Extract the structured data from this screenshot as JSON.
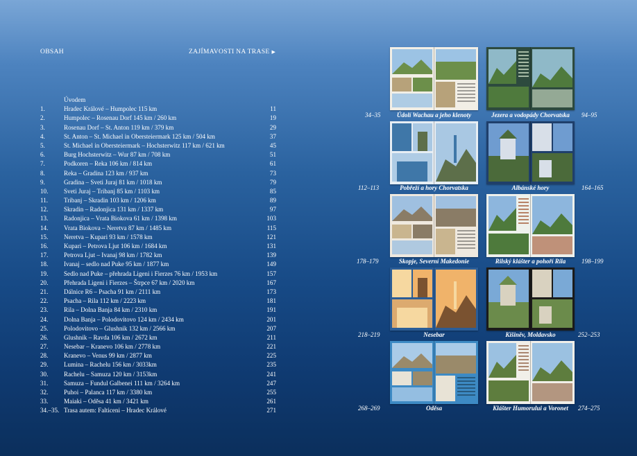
{
  "header": {
    "left": "OBSAH",
    "right": "ZAJÍMAVOSTI NA TRASE"
  },
  "toc": [
    {
      "num": "",
      "title": "Úvodem",
      "page": ""
    },
    {
      "num": "1.",
      "title": "Hradec Králové – Humpolec 115 km",
      "page": "11"
    },
    {
      "num": "2.",
      "title": "Humpolec – Rosenau Dorf 145 km / 260 km",
      "page": "19"
    },
    {
      "num": "3.",
      "title": "Rosenau Dorf – St. Anton 119 km / 379 km",
      "page": "29"
    },
    {
      "num": "4.",
      "title": "St. Anton – St. Michael in Obersteiermark 125 km / 504 km",
      "page": "37"
    },
    {
      "num": "5.",
      "title": "St. Michael in Obersteiermark – Hochsterwitz 117 km / 621 km",
      "page": "45"
    },
    {
      "num": "6.",
      "title": "Burg Hochsterwitz – Wur 87 km / 708 km",
      "page": "51"
    },
    {
      "num": "7.",
      "title": "Podkoren – Reka 106 km / 814 km",
      "page": "61"
    },
    {
      "num": "8.",
      "title": "Reka – Gradina 123 km / 937 km",
      "page": "73"
    },
    {
      "num": "9.",
      "title": "Gradina – Sveti Juraj 81 km / 1018 km",
      "page": "79"
    },
    {
      "num": "10.",
      "title": "Sveti Juraj – Tribanj 85 km / 1103 km",
      "page": "85"
    },
    {
      "num": "11.",
      "title": "Tribanj – Skradin 103 km / 1206 km",
      "page": "89"
    },
    {
      "num": "12.",
      "title": "Skradin – Radonjica 131 km / 1337 km",
      "page": "97"
    },
    {
      "num": "13.",
      "title": "Radonjica – Vrata Biokova 61 km / 1398 km",
      "page": "103"
    },
    {
      "num": "14.",
      "title": "Vrata Biokova – Neretva 87 km / 1485 km",
      "page": "115"
    },
    {
      "num": "15.",
      "title": "Neretva – Kupari  93 km / 1578 km",
      "page": "121"
    },
    {
      "num": "16.",
      "title": "Kupari – Petrova Ljut 106 km / 1684 km",
      "page": "131"
    },
    {
      "num": "17.",
      "title": "Petrova Ljut – Ivanaj  98 km / 1782 km",
      "page": "139"
    },
    {
      "num": "18.",
      "title": "Ivanaj – sedlo nad Puke  95 km / 1877 km",
      "page": "149"
    },
    {
      "num": "19.",
      "title": "Sedlo nad Puke – přehrada Ligeni i Fierzes 76 km / 1953 km",
      "page": "157"
    },
    {
      "num": "20.",
      "title": "Přehrada Ligeni i Fierzes – Štrpce 67 km / 2020 km",
      "page": "167"
    },
    {
      "num": "21.",
      "title": "Dálnice R6 – Psacha 91 km / 2111 km",
      "page": "173"
    },
    {
      "num": "22.",
      "title": "Psacha – Rila 112 km / 2223 km",
      "page": "181"
    },
    {
      "num": "23.",
      "title": "Rila – Dolna Banja 84 km / 2310 km",
      "page": "191"
    },
    {
      "num": "24.",
      "title": "Dolna Banja – Polodovitovo 124 km / 2434 km",
      "page": "201"
    },
    {
      "num": "25.",
      "title": "Polodovitovo – Glushnik 132 km / 2566 km",
      "page": "207"
    },
    {
      "num": "26.",
      "title": "Glushnik – Ravda 106 km / 2672 km",
      "page": "211"
    },
    {
      "num": "27.",
      "title": "Nesebar – Kranevo 106 km / 2778 km",
      "page": "221"
    },
    {
      "num": "28.",
      "title": "Kranevo – Venus  99 km / 2877 km",
      "page": "225"
    },
    {
      "num": "29.",
      "title": "Lumina – Rachelu 156 km / 3033km",
      "page": "235"
    },
    {
      "num": "30.",
      "title": "Rachelu – Samuza 120 km / 3153km",
      "page": "241"
    },
    {
      "num": "31.",
      "title": "Samuza – Fundul Galbenei 111 km / 3264 km",
      "page": "247"
    },
    {
      "num": "32.",
      "title": "Puhoi – Palanca 117 km / 3380 km",
      "page": "255"
    },
    {
      "num": "33.",
      "title": "Maiaki – Oděsa 41 km / 3421 km",
      "page": "261"
    },
    {
      "num": "34.–35.",
      "title": "Trasa autem: Falticeni – Hradec Králové",
      "page": "271"
    }
  ],
  "attractions": [
    {
      "caption": "Údolí Wachau a jeho klenoty",
      "pages": "34–35",
      "palette": {
        "bg": "#f2efe6",
        "sky": "#9cc3e4",
        "land": "#6c8f4a",
        "accent": "#b7a27a"
      }
    },
    {
      "caption": "Jezera a vodopády Chorvatska",
      "pages": "94–95",
      "palette": {
        "bg": "#2d4a3e",
        "sky": "#8fb9c8",
        "land": "#4f7a3d",
        "accent": "#d9ead0"
      }
    },
    {
      "caption": "Pobřeží a hory Chorvatska",
      "pages": "112–113",
      "palette": {
        "bg": "#e7eef4",
        "sky": "#a9c8e3",
        "land": "#5d6f4a",
        "accent": "#3f77a8"
      }
    },
    {
      "caption": "Albánské hory",
      "pages": "164–165",
      "palette": {
        "bg": "#1f3f6b",
        "sky": "#6f9cd0",
        "land": "#4b6a3a",
        "accent": "#d8dfe8"
      }
    },
    {
      "caption": "Skopje, Severní Makedonie",
      "pages": "178–179",
      "palette": {
        "bg": "#efe9df",
        "sky": "#9fc0e0",
        "land": "#8a7c66",
        "accent": "#c9b58f"
      }
    },
    {
      "caption": "Rilský klášter a pohoří Rila",
      "pages": "198–199",
      "palette": {
        "bg": "#eef1ec",
        "sky": "#8db6dd",
        "land": "#4e7a3c",
        "accent": "#a0522d"
      }
    },
    {
      "caption": "Nesebar",
      "pages": "218–219",
      "palette": {
        "bg": "#2b5d97",
        "sky": "#f0b36a",
        "land": "#7a5230",
        "accent": "#f6d8a0"
      }
    },
    {
      "caption": "Kišiněv, Moldavsko",
      "pages": "252–253",
      "palette": {
        "bg": "#1b1b1b",
        "sky": "#7aa9d6",
        "land": "#6b8b4b",
        "accent": "#d9d2c0"
      }
    },
    {
      "caption": "Oděsa",
      "pages": "268–269",
      "palette": {
        "bg": "#3d8ac4",
        "sky": "#aacbe8",
        "land": "#9a8a6a",
        "accent": "#e8e3d6"
      }
    },
    {
      "caption": "Klášter Humorului a Voronet",
      "pages": "274–275",
      "palette": {
        "bg": "#f1efe9",
        "sky": "#9bc1e1",
        "land": "#5e7d3e",
        "accent": "#8a5a3a"
      }
    }
  ]
}
